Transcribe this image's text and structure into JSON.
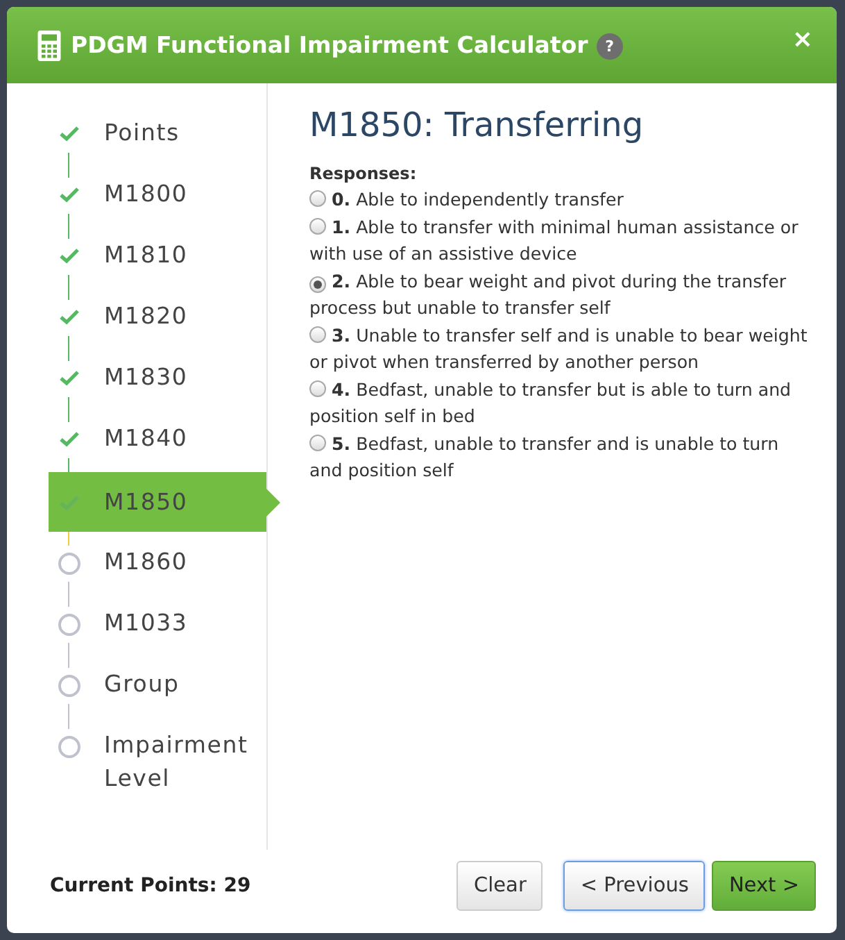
{
  "dialog": {
    "title": "PDGM Functional Impairment Calculator",
    "help": "?",
    "close": "×"
  },
  "steps": [
    {
      "label": "Points",
      "completed": true,
      "selected": false
    },
    {
      "label": "M1800",
      "completed": true,
      "selected": false
    },
    {
      "label": "M1810",
      "completed": true,
      "selected": false
    },
    {
      "label": "M1820",
      "completed": true,
      "selected": false
    },
    {
      "label": "M1830",
      "completed": true,
      "selected": false
    },
    {
      "label": "M1840",
      "completed": true,
      "selected": false
    },
    {
      "label": "M1850",
      "completed": true,
      "selected": true
    },
    {
      "label": "M1860",
      "completed": false,
      "selected": false
    },
    {
      "label": "M1033",
      "completed": false,
      "selected": false
    },
    {
      "label": "Group",
      "completed": false,
      "selected": false
    },
    {
      "label": "Impairment Level",
      "completed": false,
      "selected": false
    }
  ],
  "question": {
    "title": "M1850: Transferring",
    "responses_label": "Responses:",
    "responses": [
      {
        "number": "0.",
        "text": "Able to independently transfer",
        "selected": false
      },
      {
        "number": "1.",
        "text": "Able to transfer with minimal human assistance or with use of an assistive device",
        "selected": false
      },
      {
        "number": "2.",
        "text": "Able to bear weight and pivot during the transfer process but unable to transfer self",
        "selected": true
      },
      {
        "number": "3.",
        "text": "Unable to transfer self and is unable to bear weight or pivot when transferred by another person",
        "selected": false
      },
      {
        "number": "4.",
        "text": "Bedfast, unable to transfer but is able to turn and position self in bed",
        "selected": false
      },
      {
        "number": "5.",
        "text": "Bedfast, unable to transfer and is unable to turn and position self",
        "selected": false
      }
    ]
  },
  "footer": {
    "points": "Current Points: 29",
    "buttons": [
      {
        "label": "Clear",
        "kind": "default"
      },
      {
        "label": "< Previous",
        "kind": "focused"
      },
      {
        "label": "Next >",
        "kind": "primary"
      }
    ]
  }
}
